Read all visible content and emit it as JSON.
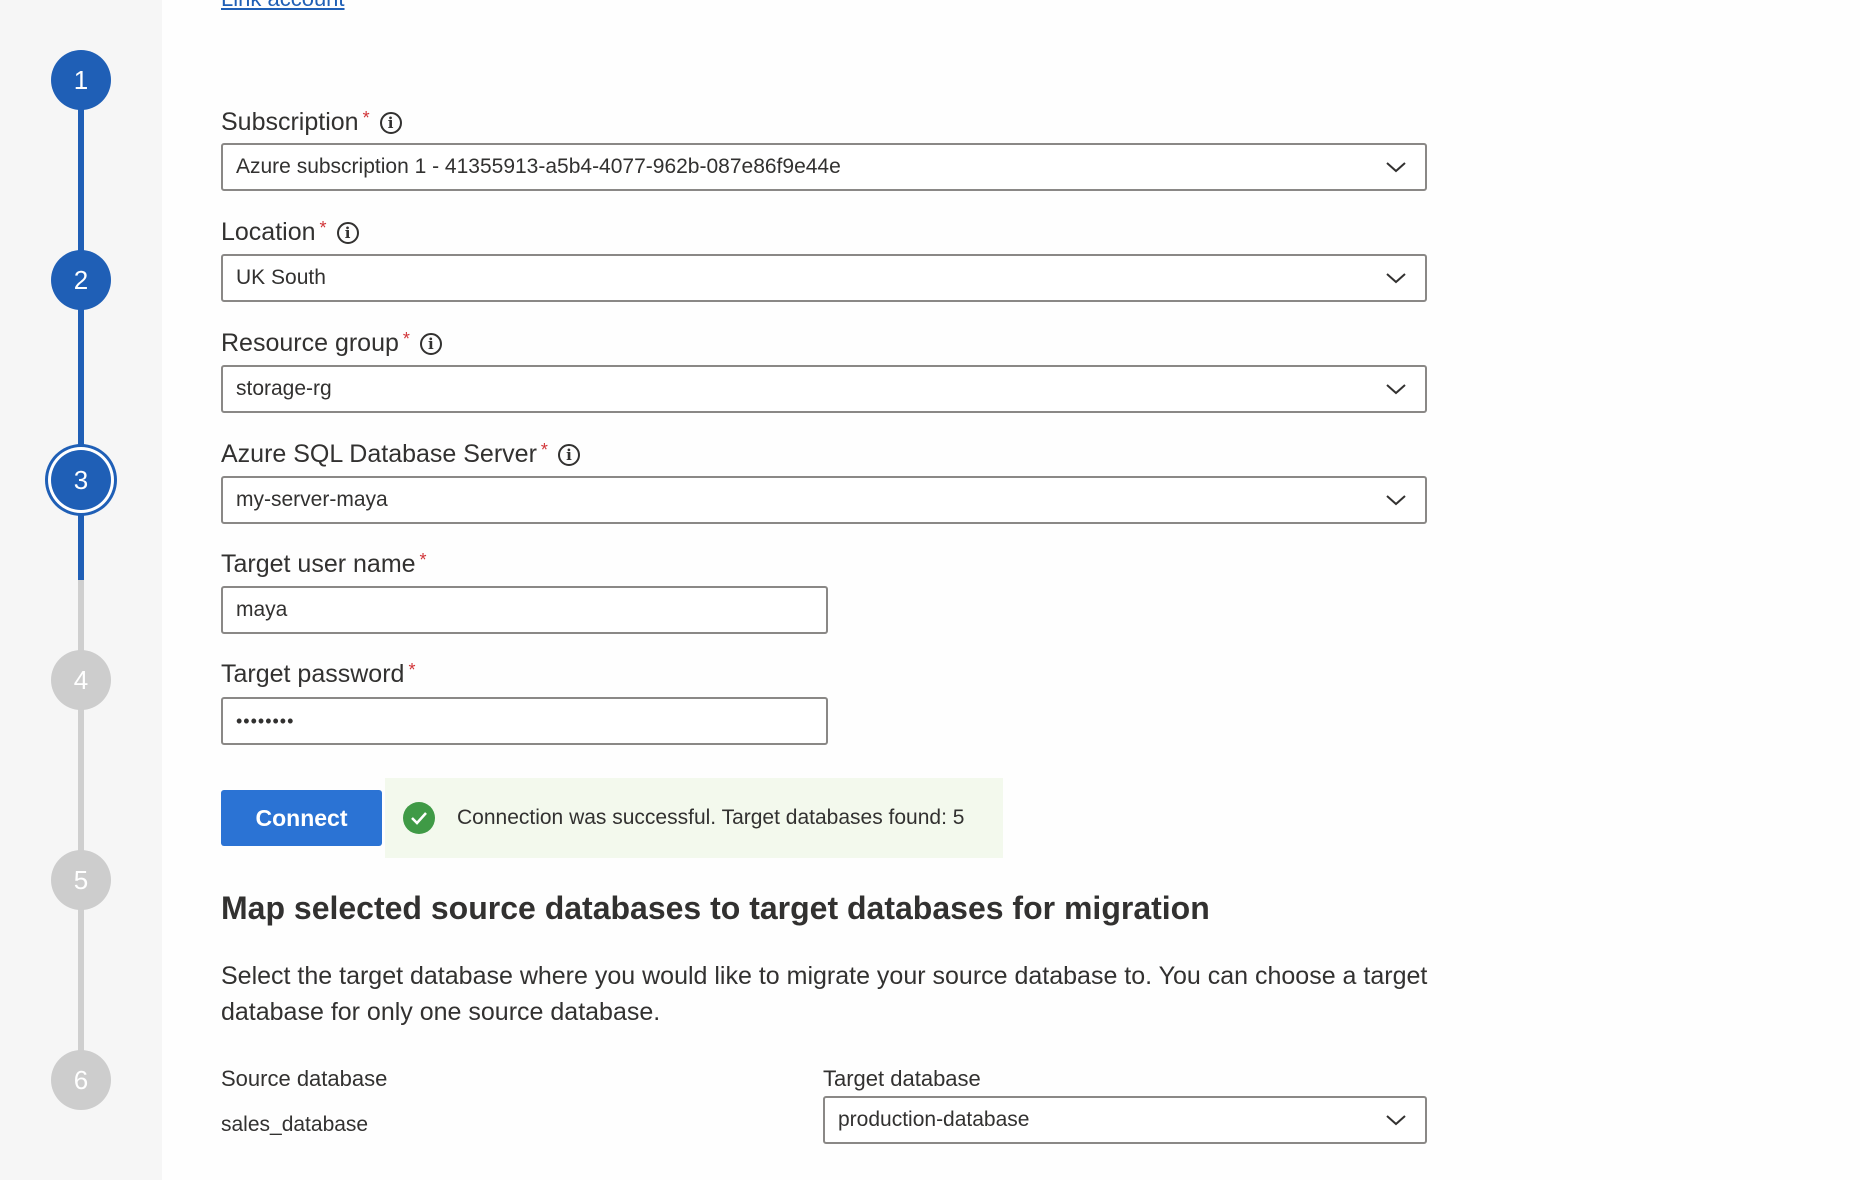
{
  "link_account": "Link account",
  "steps": [
    "1",
    "2",
    "3",
    "4",
    "5",
    "6"
  ],
  "current_step": 3,
  "fields": {
    "subscription": {
      "label": "Subscription",
      "value": "Azure subscription 1 - 41355913-a5b4-4077-962b-087e86f9e44e"
    },
    "location": {
      "label": "Location",
      "value": "UK South"
    },
    "resource_group": {
      "label": "Resource group",
      "value": "storage-rg"
    },
    "server": {
      "label": "Azure SQL Database Server",
      "value": "my-server-maya"
    },
    "user_name": {
      "label": "Target user name",
      "value": "maya"
    },
    "password": {
      "label": "Target password",
      "value": "••••••••"
    }
  },
  "required_mark": "*",
  "info_glyph": "i",
  "connect_label": "Connect",
  "success_message": "Connection was successful. Target databases found: 5",
  "section": {
    "title": "Map selected source databases to target databases for migration",
    "description": "Select the target database where you would like to migrate your source database to. You can choose a target database for only one source database."
  },
  "mapping": {
    "source_header": "Source database",
    "target_header": "Target database",
    "source_value": "sales_database",
    "target_value": "production-database"
  },
  "colors": {
    "accent": "#1f5fb6",
    "button": "#2b73d4",
    "success": "#3f9a46",
    "required": "#d13438"
  }
}
